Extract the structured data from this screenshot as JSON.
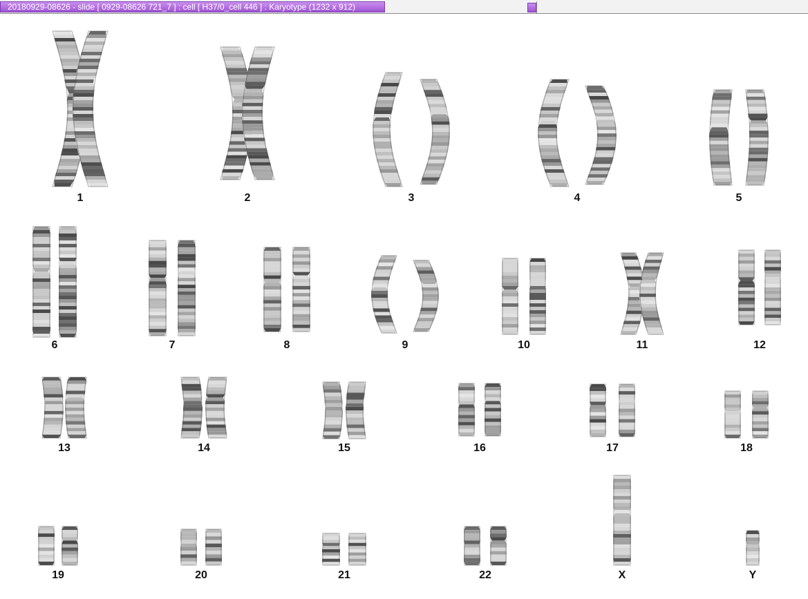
{
  "window": {
    "title": "20180929-08626 - slide [ 0929-08626 721_7 ] : cell [ H37/0_cell 446 ] : Karyotype  (1232 x 912)"
  },
  "karyotype": {
    "chromosomes": [
      {
        "label": "1"
      },
      {
        "label": "2"
      },
      {
        "label": "3"
      },
      {
        "label": "4"
      },
      {
        "label": "5"
      },
      {
        "label": "6"
      },
      {
        "label": "7"
      },
      {
        "label": "8"
      },
      {
        "label": "9"
      },
      {
        "label": "10"
      },
      {
        "label": "11"
      },
      {
        "label": "12"
      },
      {
        "label": "13"
      },
      {
        "label": "14"
      },
      {
        "label": "15"
      },
      {
        "label": "16"
      },
      {
        "label": "17"
      },
      {
        "label": "18"
      },
      {
        "label": "19"
      },
      {
        "label": "20"
      },
      {
        "label": "21"
      },
      {
        "label": "22"
      },
      {
        "label": "X"
      },
      {
        "label": "Y"
      }
    ]
  }
}
